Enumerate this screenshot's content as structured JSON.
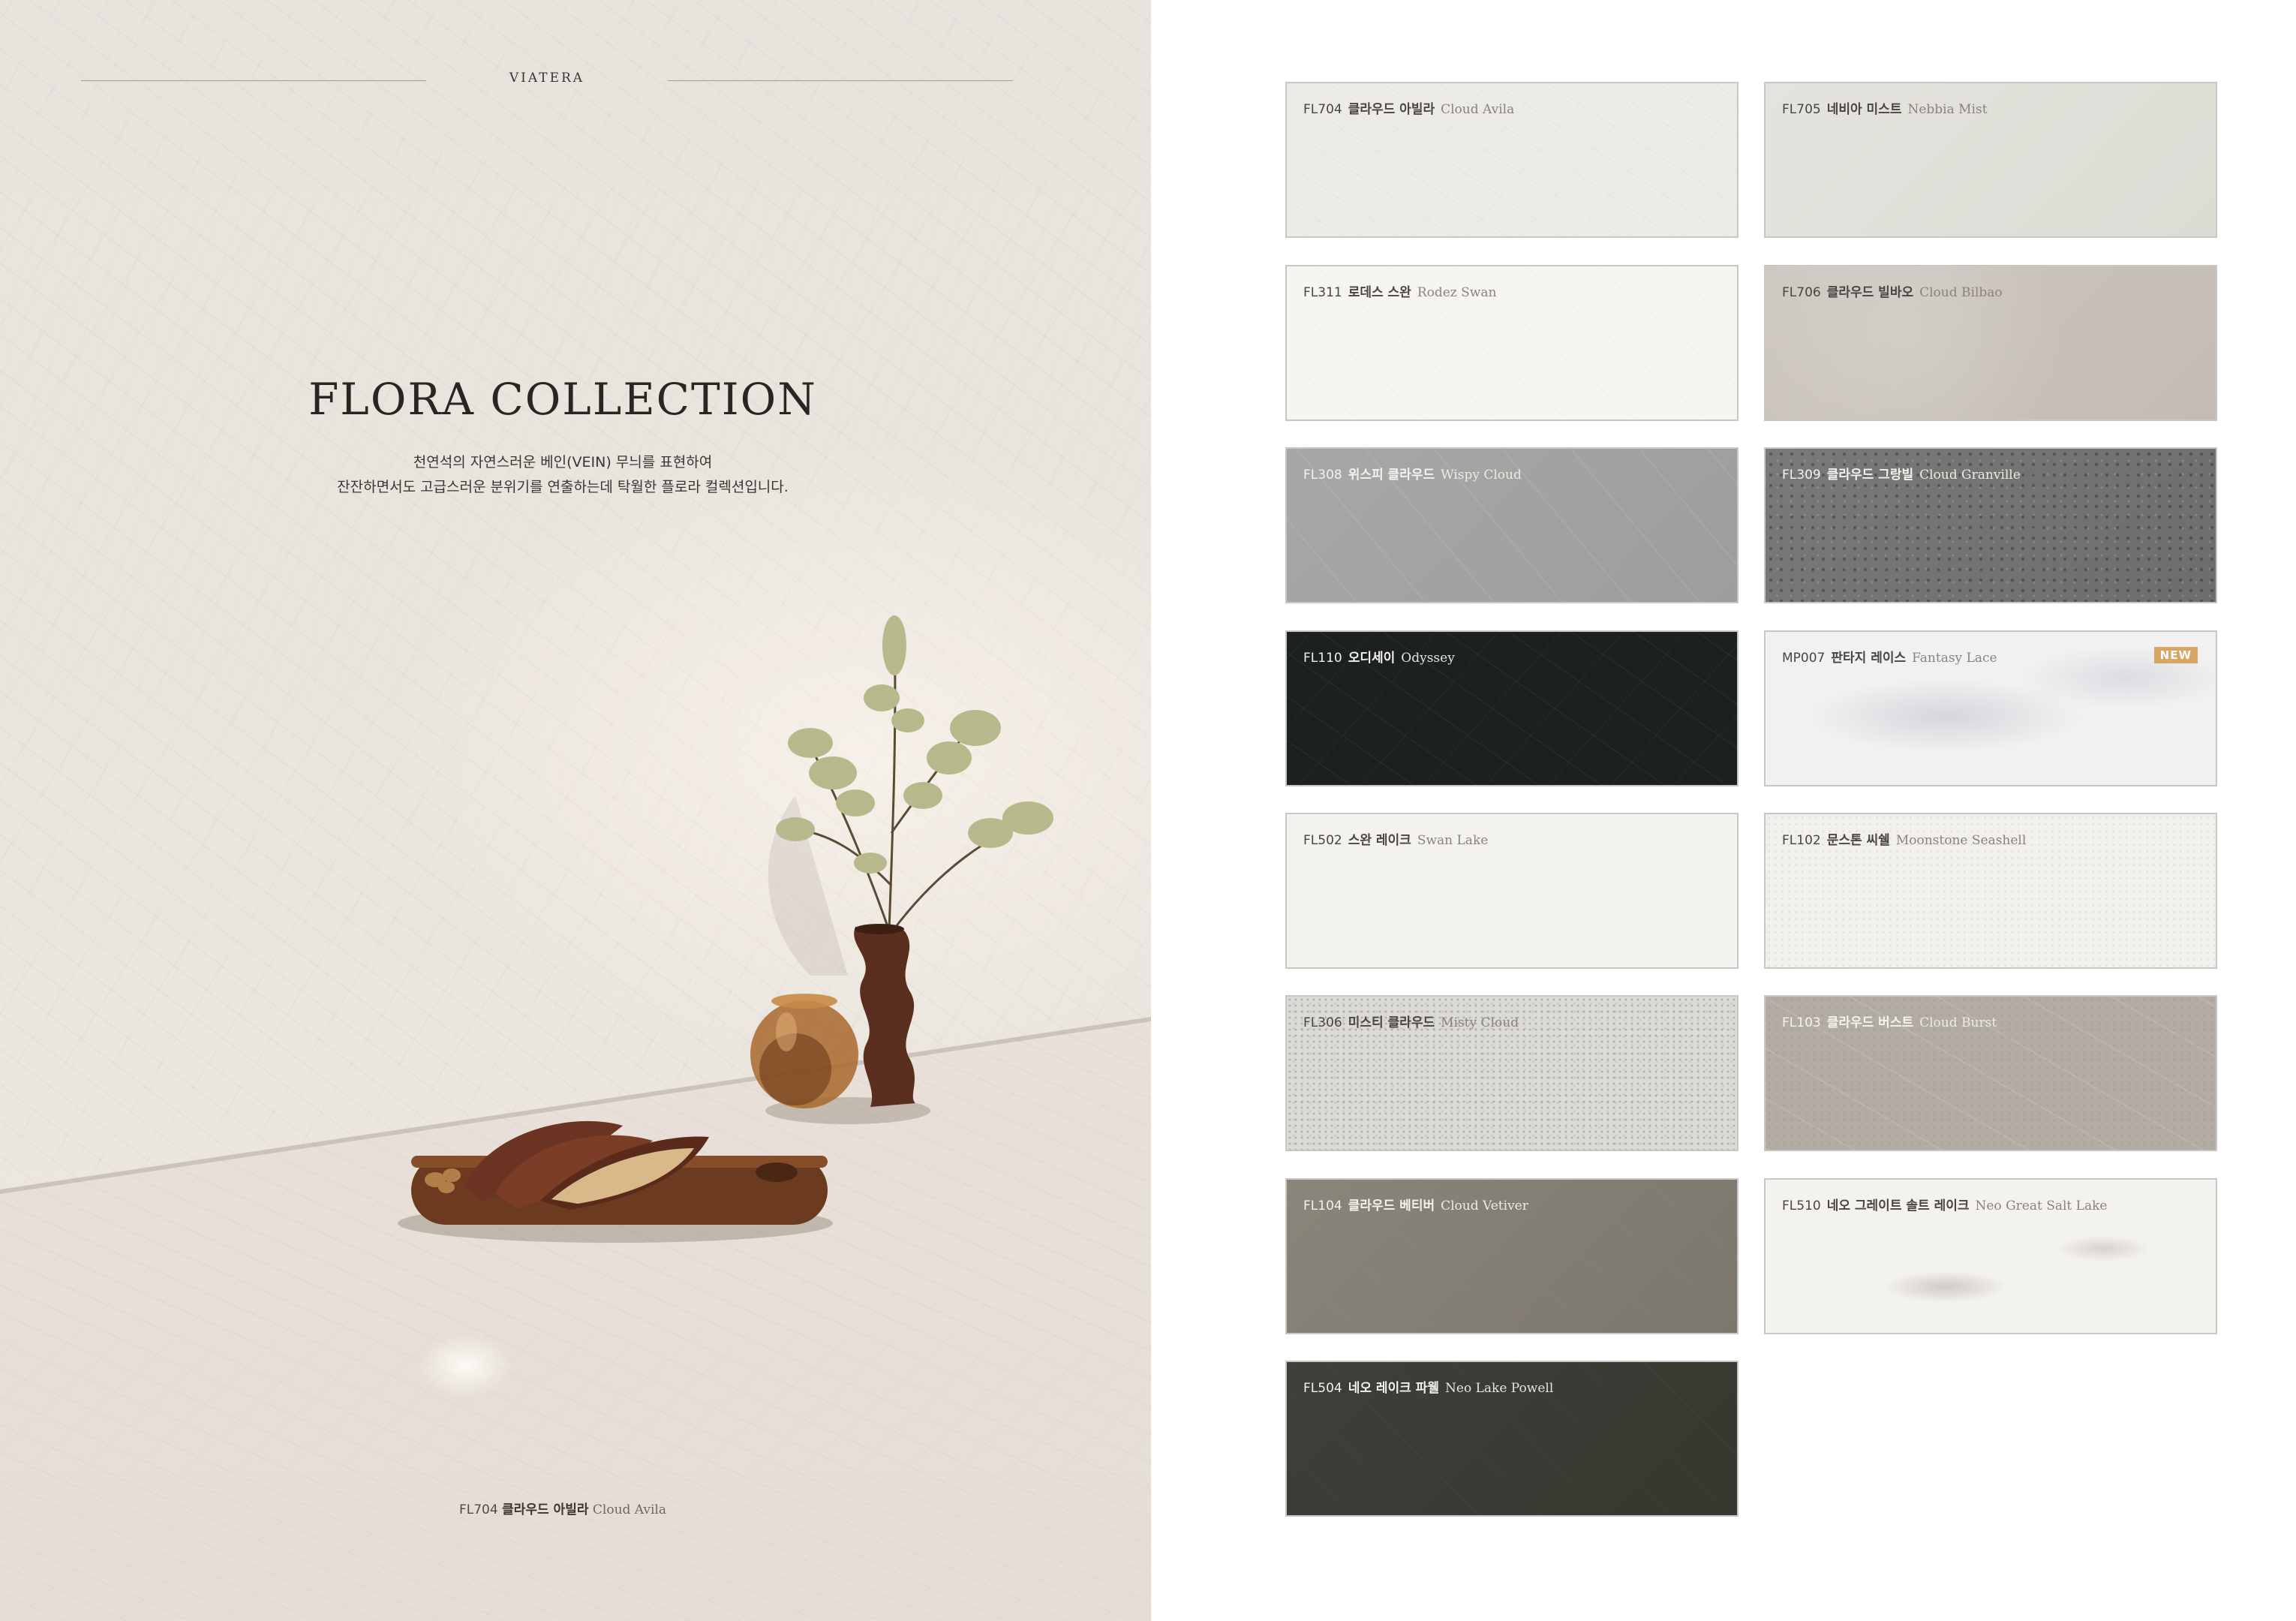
{
  "cover": {
    "brand": "VIATERA",
    "title": "FLORA COLLECTION",
    "description_line1": "천연석의 자연스러운 베인(VEIN) 무늬를 표현하여",
    "description_line2": "잔잔하면서도 고급스러운 분위기를 연출하는데 탁월한 플로라 컬렉션입니다.",
    "caption": {
      "code": "FL704",
      "kr": "클라우드 아빌라",
      "en": "Cloud Avila"
    }
  },
  "swatches": [
    {
      "code": "FL704",
      "kr": "클라우드 아빌라",
      "en": "Cloud Avila",
      "color": "#ecebe5"
    },
    {
      "code": "FL705",
      "kr": "네비아 미스트",
      "en": "Nebbia Mist",
      "color": "#e0dfd9"
    },
    {
      "code": "FL311",
      "kr": "로데스 스완",
      "en": "Rodez Swan",
      "color": "#f6f5f1"
    },
    {
      "code": "FL706",
      "kr": "클라우드 빌바오",
      "en": "Cloud Bilbao",
      "color": "#c8c2ba"
    },
    {
      "code": "FL308",
      "kr": "위스피 클라우드",
      "en": "Wispy Cloud",
      "color": "#a2a2a1"
    },
    {
      "code": "FL309",
      "kr": "클라우드 그랑빌",
      "en": "Cloud Granville",
      "color": "#747372"
    },
    {
      "code": "FL110",
      "kr": "오디세이",
      "en": "Odyssey",
      "color": "#1c2120"
    },
    {
      "code": "MP007",
      "kr": "판타지 레이스",
      "en": "Fantasy Lace",
      "color": "#f1f1f2",
      "badge": "NEW"
    },
    {
      "code": "FL502",
      "kr": "스완 레이크",
      "en": "Swan Lake",
      "color": "#f3f2ef"
    },
    {
      "code": "FL102",
      "kr": "문스톤 씨쉘",
      "en": "Moonstone Seashell",
      "color": "#f1f0ec"
    },
    {
      "code": "FL306",
      "kr": "미스티 클라우드",
      "en": "Misty Cloud",
      "color": "#dcdad6"
    },
    {
      "code": "FL103",
      "kr": "클라우드 버스트",
      "en": "Cloud Burst",
      "color": "#b3aca4"
    },
    {
      "code": "FL104",
      "kr": "클라우드 베티버",
      "en": "Cloud Vetiver",
      "color": "#837e73"
    },
    {
      "code": "FL510",
      "kr": "네오 그레이트 솔트 레이크",
      "en": "Neo Great Salt Lake",
      "color": "#f4f2ef"
    },
    {
      "code": "FL504",
      "kr": "네오 레이크 파웰",
      "en": "Neo Lake Powell",
      "color": "#3b3b35"
    }
  ]
}
